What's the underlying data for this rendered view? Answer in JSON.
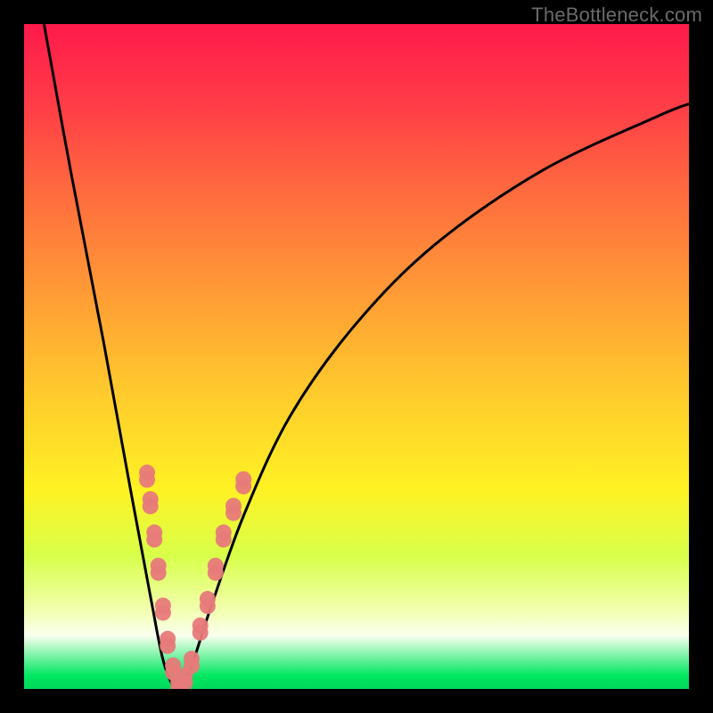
{
  "watermark": "TheBottleneck.com",
  "colors": {
    "background": "#000000",
    "curve": "#000000",
    "marker_fill": "#e77a7a",
    "marker_stroke": "#d85c5c",
    "gradient_top": "#ff1a4b",
    "gradient_bottom": "#00d85a"
  },
  "chart_data": {
    "type": "line",
    "title": "",
    "xlabel": "",
    "ylabel": "",
    "xlim": [
      0,
      100
    ],
    "ylim": [
      0,
      100
    ],
    "grid": false,
    "legend": false,
    "notes": "V-shaped bottleneck curve. Minimum near x≈23. Axes have no visible tick labels; values estimated from pixel position within 746×746 plot area (0 at axes, 100 at opposite edges).",
    "series": [
      {
        "name": "bottleneck-curve",
        "x": [
          3,
          7,
          12,
          16,
          19,
          21,
          23,
          25,
          28,
          33,
          40,
          50,
          62,
          78,
          95,
          100
        ],
        "y": [
          100,
          78,
          52,
          30,
          14,
          4,
          0,
          3,
          12,
          26,
          41,
          55,
          67,
          78,
          86,
          88
        ]
      }
    ],
    "markers": {
      "name": "highlighted-points",
      "comment": "Pink capsule-like markers clustered along both arms near the trough.",
      "points": [
        {
          "x": 18.5,
          "y": 32
        },
        {
          "x": 19.0,
          "y": 28
        },
        {
          "x": 19.6,
          "y": 23
        },
        {
          "x": 20.2,
          "y": 18
        },
        {
          "x": 20.9,
          "y": 12
        },
        {
          "x": 21.6,
          "y": 7
        },
        {
          "x": 22.4,
          "y": 3
        },
        {
          "x": 23.2,
          "y": 0.5
        },
        {
          "x": 24.2,
          "y": 1.5
        },
        {
          "x": 25.2,
          "y": 4
        },
        {
          "x": 26.5,
          "y": 9
        },
        {
          "x": 27.6,
          "y": 13
        },
        {
          "x": 28.8,
          "y": 18
        },
        {
          "x": 30.0,
          "y": 23
        },
        {
          "x": 31.5,
          "y": 27
        },
        {
          "x": 33.0,
          "y": 31
        }
      ]
    }
  }
}
